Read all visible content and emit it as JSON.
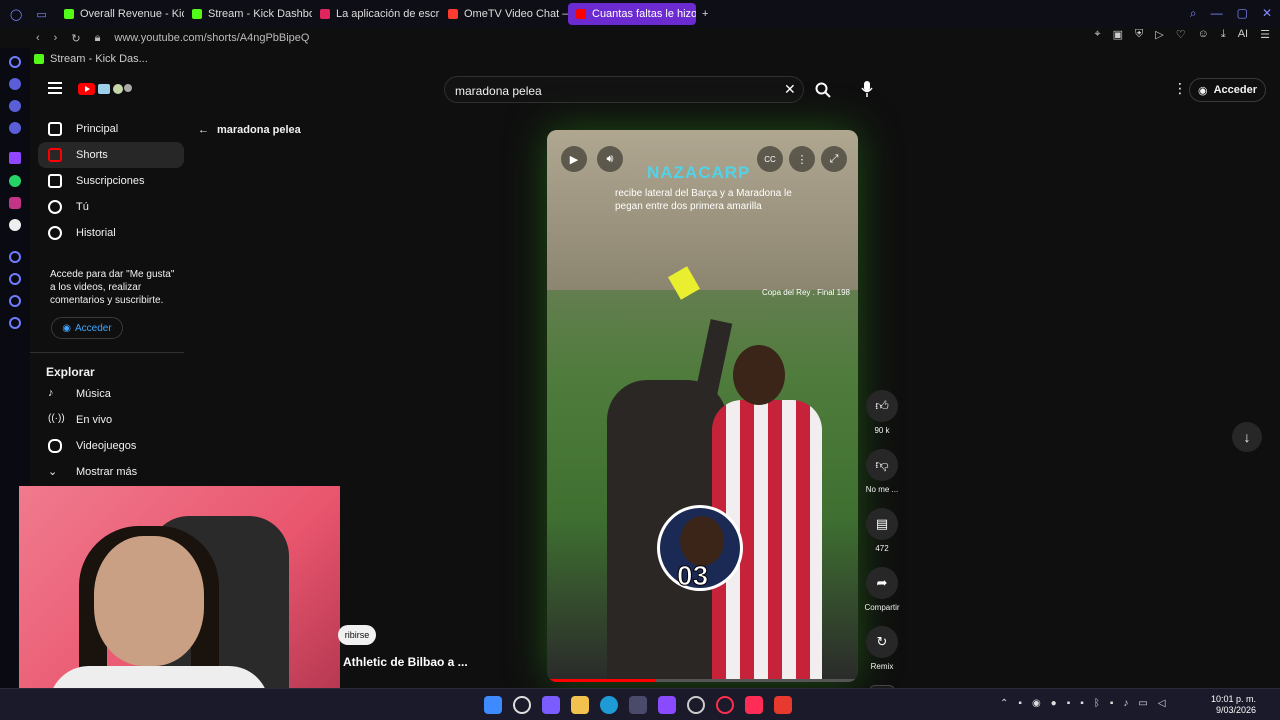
{
  "browser": {
    "tabs": [
      {
        "label": "Overall Revenue - Kick Das",
        "color": "#53fc18"
      },
      {
        "label": "Stream - Kick Dashboa",
        "color": "#53fc18"
      },
      {
        "label": "La aplicación de escritorio",
        "color": "#e0245e"
      },
      {
        "label": "OmeTV Video Chat — Om",
        "color": "#ff3b30"
      },
      {
        "label": "Cuantas faltas le hizo Athl",
        "color": "#ff0000"
      }
    ],
    "url": "www.youtube.com/shorts/A4ngPbBipeQ",
    "bookmark": "Stream - Kick Das..."
  },
  "youtube": {
    "search_value": "maradona pelea",
    "acceder": "Acceder",
    "sidebar": {
      "items": [
        {
          "label": "Principal",
          "icon": "home-icon"
        },
        {
          "label": "Shorts",
          "icon": "shorts-icon"
        },
        {
          "label": "Suscripciones",
          "icon": "subscriptions-icon"
        },
        {
          "label": "Tú",
          "icon": "user-icon"
        },
        {
          "label": "Historial",
          "icon": "history-icon"
        }
      ],
      "note": "Accede para dar \"Me gusta\" a los videos, realizar comentarios y suscribirte.",
      "acceder": "Acceder",
      "explorar": "Explorar",
      "explore_items": [
        {
          "label": "Música",
          "icon": "music-icon"
        },
        {
          "label": "En vivo",
          "icon": "live-icon"
        },
        {
          "label": "Videojuegos",
          "icon": "gaming-icon"
        },
        {
          "label": "Mostrar más",
          "icon": "chevron-down-icon"
        }
      ]
    },
    "back_label": "maradona pelea",
    "short": {
      "brand": "NAZACARP",
      "caption": "recibe lateral del Barça y a Maradona le pegan entre dos primera amarilla",
      "overlay": "Copa del Rey . Final 198",
      "badge_number": "03",
      "progress_pct": 0.35
    },
    "actions": [
      {
        "label": "90 k",
        "icon": "like-icon"
      },
      {
        "label": "No me ...",
        "icon": "dislike-icon"
      },
      {
        "label": "472",
        "icon": "comment-icon"
      },
      {
        "label": "Compartir",
        "icon": "share-icon"
      },
      {
        "label": "Remix",
        "icon": "remix-icon"
      }
    ],
    "channel_title": "Athletic de Bilbao a ...",
    "subscribe_fragment": "ribirse"
  },
  "taskbar": {
    "time": "10:01 p. m.",
    "date": "9/03/2026"
  }
}
